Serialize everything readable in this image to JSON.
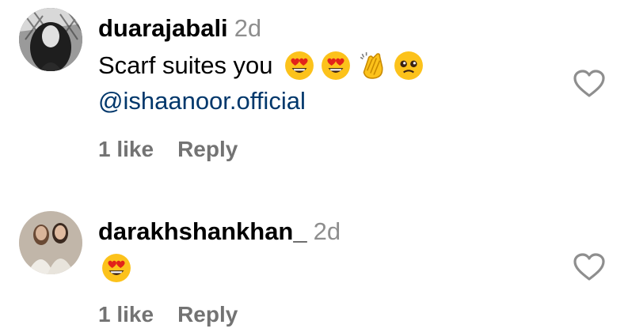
{
  "comments": [
    {
      "username": "duarajabali",
      "time": "2d",
      "text": "Scarf suites you",
      "emojis": [
        "heart-eyes-emoji",
        "heart-eyes-emoji",
        "clapping-hands-emoji",
        "pleading-face-emoji"
      ],
      "mention": "@ishaanoor.official",
      "likes": "1 like",
      "reply": "Reply"
    },
    {
      "username": "darakhshankhan_",
      "time": "2d",
      "text": "",
      "emojis": [
        "heart-eyes-emoji"
      ],
      "likes": "1 like",
      "reply": "Reply"
    }
  ],
  "colors": {
    "meta": "#8e8e8e",
    "mention": "#00376b",
    "actions": "#737373"
  }
}
